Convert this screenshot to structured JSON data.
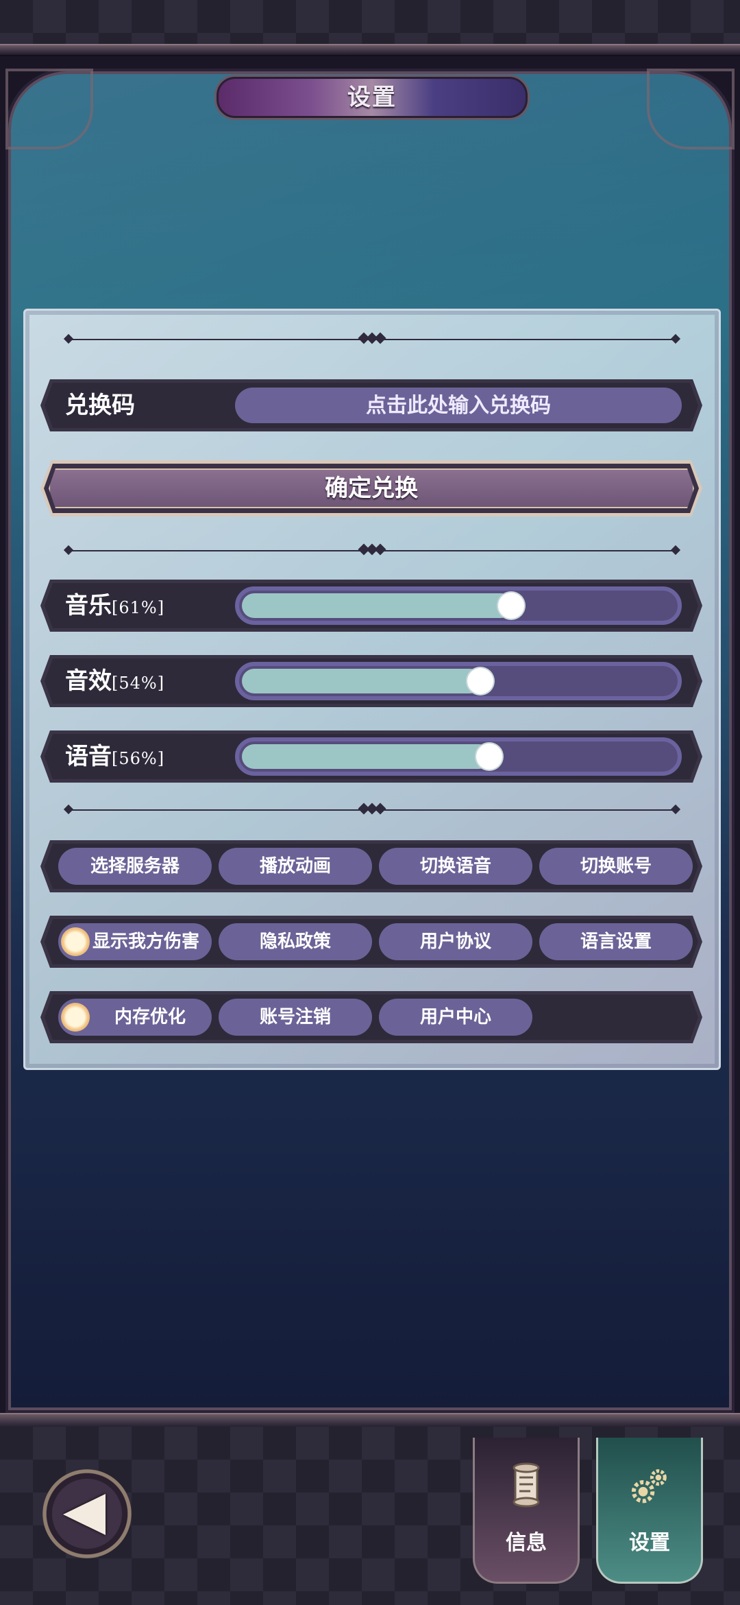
{
  "header": {
    "title": "设置"
  },
  "redeem": {
    "label": "兑换码",
    "placeholder": "点击此处输入兑换码",
    "confirm_label": "确定兑换"
  },
  "sliders": [
    {
      "name": "音乐",
      "percent_text": "[61%]",
      "value": 0.61
    },
    {
      "name": "音效",
      "percent_text": "[54%]",
      "value": 0.54
    },
    {
      "name": "语音",
      "percent_text": "[56%]",
      "value": 0.56
    }
  ],
  "buttons": {
    "row1": [
      "选择服务器",
      "播放动画",
      "切换语音",
      "切换账号"
    ],
    "row2": [
      "显示我方伤害",
      "隐私政策",
      "用户协议",
      "语言设置"
    ],
    "row3": [
      "内存优化",
      "账号注销",
      "用户中心"
    ]
  },
  "toggles": {
    "show_damage": true,
    "memory_optimize": true
  },
  "bottom_nav": {
    "tabs": [
      {
        "label": "信息",
        "icon": "scroll-icon"
      },
      {
        "label": "设置",
        "icon": "gears-icon",
        "active": true
      }
    ],
    "back_icon": "back-arrow-icon"
  },
  "colors": {
    "accent_pill": "#6b6397",
    "slider_fill": "#9cc6c6",
    "active_tab": "#4d8d86"
  }
}
